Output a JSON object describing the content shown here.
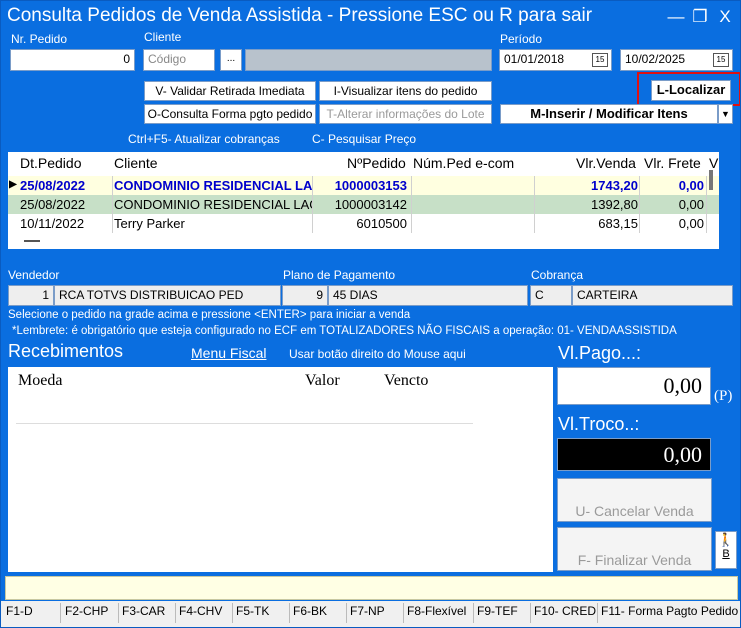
{
  "title": "Consulta Pedidos de Venda Assistida - Pressione ESC ou R para sair",
  "controls": {
    "minimize": "—",
    "restore": "❐",
    "close": "X"
  },
  "filters": {
    "nr_pedido_label": "Nr. Pedido",
    "nr_pedido_value": "0",
    "cliente_label": "Cliente",
    "cliente_placeholder": "Código",
    "dots": "...",
    "periodo_label": "Período",
    "date_from": "01/01/2018",
    "date_to": "10/02/2025",
    "cal_icon": "15"
  },
  "buttons": {
    "validar": "V- Validar Retirada Imediata",
    "visualizar": "I-Visualizar itens do pedido",
    "localizar": "L-Localizar",
    "consulta_forma": "O-Consulta Forma pgto pedido",
    "alterar_lote": "T-Alterar informações do Lote",
    "inserir": "M-Inserir / Modificar Itens",
    "atualizar": "Ctrl+F5- Atualizar cobranças",
    "pesquisar": "C- Pesquisar Preço"
  },
  "grid": {
    "headers": [
      "Dt.Pedido",
      "Cliente",
      "NºPedido",
      "Núm.Ped e-com",
      "Vlr.Venda",
      "Vlr. Frete",
      "V"
    ],
    "rows": [
      {
        "date": "25/08/2022",
        "cliente": "CONDOMINIO RESIDENCIAL LAG",
        "pedido": "1000003153",
        "ecom": "",
        "venda": "1743,20",
        "frete": "0,00"
      },
      {
        "date": "25/08/2022",
        "cliente": "CONDOMINIO RESIDENCIAL LAGOI",
        "pedido": "1000003142",
        "ecom": "",
        "venda": "1392,80",
        "frete": "0,00"
      },
      {
        "date": "10/11/2022",
        "cliente": "Terry Parker",
        "pedido": "6010500",
        "ecom": "",
        "venda": "683,15",
        "frete": "0,00"
      }
    ]
  },
  "info": {
    "vendedor_label": "Vendedor",
    "vendedor_code": "1",
    "vendedor_name": "RCA TOTVS DISTRIBUICAO PED",
    "plano_label": "Plano de Pagamento",
    "plano_code": "9",
    "plano_name": "45 DIAS",
    "cobranca_label": "Cobrança",
    "cobranca_code": "C",
    "cobranca_name": "CARTEIRA",
    "instr1": "Selecione o pedido na grade acima e pressione <ENTER> para iniciar a venda",
    "instr2": "*Lembrete: é obrigatório que esteja configurado  no ECF em TOTALIZADORES NÃO FISCAIS a operação: 01- VENDAASSISTIDA"
  },
  "recebimentos": {
    "title": "Recebimentos",
    "menu_fiscal": "Menu Fiscal",
    "hint": "Usar botão direito do Mouse aqui",
    "col_moeda": "Moeda",
    "col_valor": "Valor",
    "col_vencto": "Vencto"
  },
  "payment": {
    "pago_label": "Vl.Pago...:",
    "pago_value": "0,00",
    "p_label": "(P)",
    "troco_label": "Vl.Troco..:",
    "troco_value": "0,00",
    "cancelar": "U- Cancelar Venda",
    "finalizar": "F- Finalizar Venda",
    "b_label": "B"
  },
  "fkeys": [
    "F1-D",
    "F2-CHP",
    "F3-CAR",
    "F4-CHV",
    "F5-TK",
    "F6-BK",
    "F7-NP",
    "F8-Flexível",
    "F9-TEF",
    "F10- CRED",
    "F11- Forma Pagto Pedido"
  ]
}
